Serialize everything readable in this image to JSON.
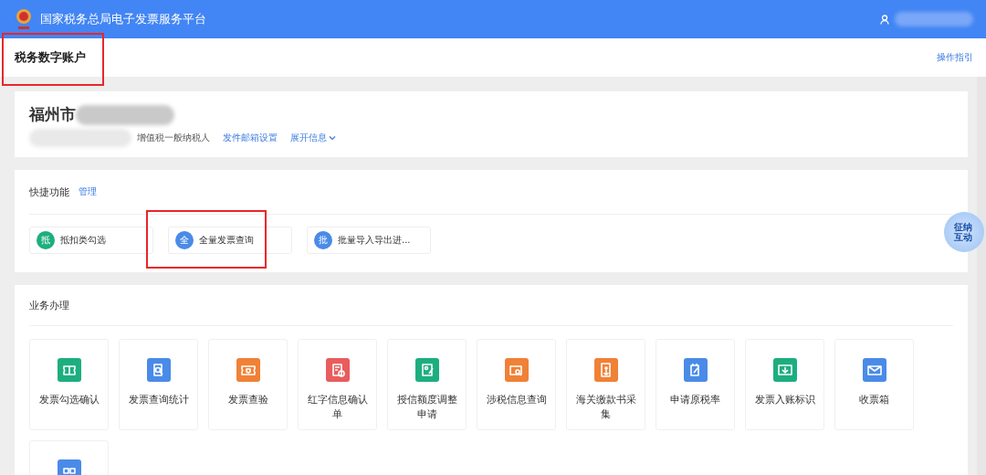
{
  "header": {
    "title": "国家税务总局电子发票服务平台"
  },
  "page": {
    "title": "税务数字账户",
    "highlighted": true,
    "guide_link": "操作指引"
  },
  "company": {
    "name": "福州市",
    "taxpayer_type": "增值税一般纳税人",
    "links": [
      "发件邮箱设置",
      "展开信息"
    ]
  },
  "quick": {
    "title": "快捷功能",
    "manage_link": "管理",
    "items": [
      {
        "badge": "抵",
        "label": "抵扣类勾选",
        "color": "#1dae7f",
        "highlighted": false
      },
      {
        "badge": "全",
        "label": "全量发票查询",
        "color": "#4a8be8",
        "highlighted": true
      },
      {
        "badge": "批",
        "label": "批量导入导出进...",
        "color": "#4a8be8",
        "highlighted": false
      }
    ]
  },
  "business": {
    "title": "业务办理",
    "items": [
      {
        "label": "发票勾选确认",
        "color": "#1dae7f"
      },
      {
        "label": "发票查询统计",
        "color": "#4a8be8"
      },
      {
        "label": "发票查验",
        "color": "#f08136"
      },
      {
        "label": "红字信息确认单",
        "color": "#e85d5d"
      },
      {
        "label": "授信额度调整申请",
        "color": "#1dae7f"
      },
      {
        "label": "涉税信息查询",
        "color": "#f08136"
      },
      {
        "label": "海关缴款书采集",
        "color": "#f08136"
      },
      {
        "label": "申请原税率",
        "color": "#4a8be8"
      },
      {
        "label": "发票入账标识",
        "color": "#1dae7f"
      },
      {
        "label": "收票箱",
        "color": "#4a8be8"
      },
      {
        "color": "#4a8be8"
      }
    ]
  },
  "assistant": {
    "label": "征纳互动"
  }
}
